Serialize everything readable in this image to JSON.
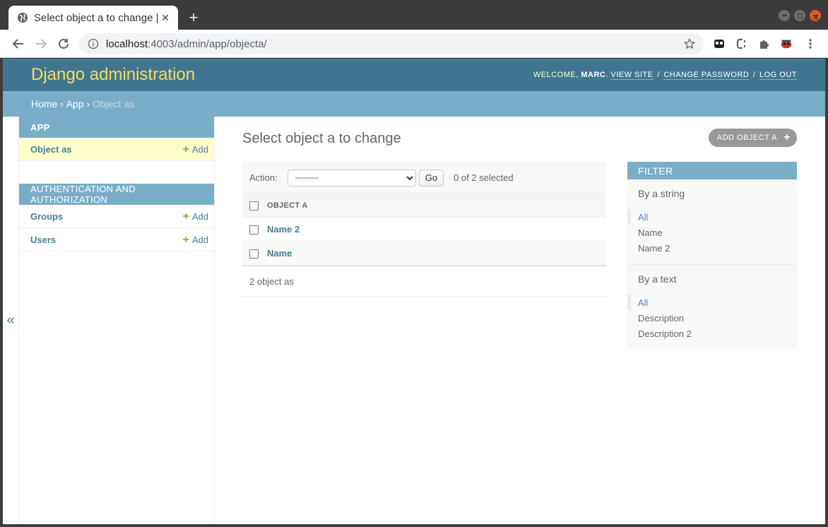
{
  "browser": {
    "tab_title": "Select object a to change | Django site admin",
    "url_host": "localhost",
    "url_path": ":4003/admin/app/objecta/"
  },
  "header": {
    "branding": "Django administration",
    "welcome": "WELCOME,",
    "user": "MARC",
    "view_site": "VIEW SITE",
    "change_password": "CHANGE PASSWORD",
    "log_out": "LOG OUT",
    "sep": "/"
  },
  "breadcrumbs": {
    "home": "Home",
    "app": "App",
    "current": "Object as",
    "arrow": "›"
  },
  "nav": {
    "toggle": "«",
    "modules": [
      {
        "caption": "APP",
        "models": [
          {
            "name": "Object as",
            "add": "Add"
          }
        ]
      },
      {
        "caption": "AUTHENTICATION AND AUTHORIZATION",
        "models": [
          {
            "name": "Groups",
            "add": "Add"
          },
          {
            "name": "Users",
            "add": "Add"
          }
        ]
      }
    ]
  },
  "content": {
    "title": "Select object a to change",
    "add_button": "ADD OBJECT A",
    "action_label": "Action:",
    "action_select": "---------",
    "go": "Go",
    "counter": "0 of 2 selected",
    "column": "OBJECT A",
    "rows": [
      "Name 2",
      "Name"
    ],
    "paginator": "2 object as"
  },
  "filter": {
    "title": "FILTER",
    "groups": [
      {
        "title": "By a string",
        "choices": [
          "All",
          "Name",
          "Name 2"
        ]
      },
      {
        "title": "By a text",
        "choices": [
          "All",
          "Description",
          "Description 2"
        ]
      }
    ]
  },
  "colors": {
    "header": "#417690",
    "accent": "#79aec8",
    "link": "#447e9b",
    "branding": "#f5dd5d",
    "add_green": "#70bf2b",
    "current_row": "#ffffcc"
  }
}
